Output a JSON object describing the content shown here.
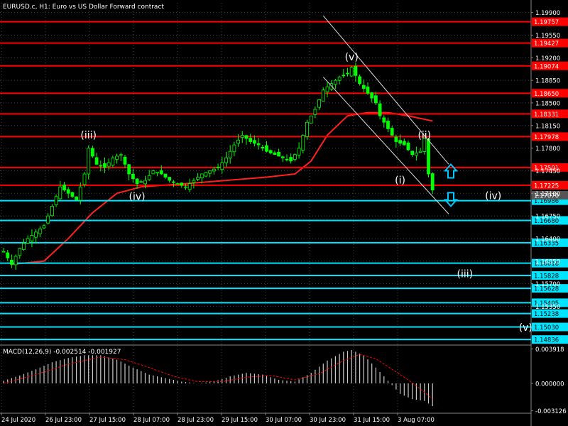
{
  "window": {
    "title": "EURUSD.c, H1:  Euro vs US Dollar Forward contract"
  },
  "macd": {
    "label": "MACD(12,26,9) -0.002514 -0.001927"
  },
  "colors": {
    "background": "#000000",
    "candle": "#00ff00",
    "moving_average": "#ff2020",
    "resistance_line": "#ff0000",
    "support_line": "#00e5ff",
    "channel": "#dddddd",
    "macd_histogram": "#cccccc",
    "macd_signal": "#ff0000",
    "wave_label": "#ffffff",
    "up_arrow": "#00c8ff",
    "down_arrow": "#00c8ff"
  },
  "chart_data": {
    "type": "candlestick",
    "symbol": "EURUSD.c",
    "timeframe": "H1",
    "y_axis_ticks": [
      "1.19900",
      "1.19550",
      "1.19200",
      "1.18850",
      "1.18500",
      "1.18150",
      "1.17800",
      "1.17450",
      "1.17100",
      "1.16750",
      "1.16400",
      "1.16050",
      "1.15700",
      "1.15350"
    ],
    "ylim": [
      1.1475,
      1.2005
    ],
    "x_axis_ticks": [
      "24 Jul 2020",
      "26 Jul 23:00",
      "27 Jul 15:00",
      "28 Jul 07:00",
      "28 Jul 23:00",
      "29 Jul 15:00",
      "30 Jul 07:00",
      "30 Jul 23:00",
      "31 Jul 15:00",
      "3 Aug 07:00"
    ],
    "price_series": {
      "type": "line",
      "interpretation": "approximate close path of the candlesticks, bar index 0..106",
      "points": [
        [
          0,
          1.162
        ],
        [
          2,
          1.16
        ],
        [
          4,
          1.1625
        ],
        [
          6,
          1.164
        ],
        [
          8,
          1.165
        ],
        [
          10,
          1.166
        ],
        [
          12,
          1.169
        ],
        [
          14,
          1.172
        ],
        [
          16,
          1.171
        ],
        [
          18,
          1.17
        ],
        [
          20,
          1.174
        ],
        [
          21,
          1.178
        ],
        [
          23,
          1.1755
        ],
        [
          25,
          1.175
        ],
        [
          27,
          1.1765
        ],
        [
          29,
          1.177
        ],
        [
          31,
          1.174
        ],
        [
          33,
          1.1725
        ],
        [
          35,
          1.173
        ],
        [
          37,
          1.1745
        ],
        [
          39,
          1.174
        ],
        [
          41,
          1.173
        ],
        [
          43,
          1.1725
        ],
        [
          45,
          1.172
        ],
        [
          47,
          1.173
        ],
        [
          49,
          1.174
        ],
        [
          51,
          1.1745
        ],
        [
          53,
          1.175
        ],
        [
          55,
          1.1765
        ],
        [
          57,
          1.1785
        ],
        [
          59,
          1.18
        ],
        [
          61,
          1.179
        ],
        [
          63,
          1.1785
        ],
        [
          65,
          1.1775
        ],
        [
          67,
          1.177
        ],
        [
          69,
          1.1765
        ],
        [
          71,
          1.176
        ],
        [
          73,
          1.178
        ],
        [
          75,
          1.182
        ],
        [
          77,
          1.184
        ],
        [
          79,
          1.187
        ],
        [
          81,
          1.188
        ],
        [
          83,
          1.189
        ],
        [
          85,
          1.1895
        ],
        [
          86,
          1.1905
        ],
        [
          88,
          1.188
        ],
        [
          90,
          1.1865
        ],
        [
          92,
          1.185
        ],
        [
          93,
          1.183
        ],
        [
          95,
          1.181
        ],
        [
          97,
          1.179
        ],
        [
          99,
          1.1785
        ],
        [
          101,
          1.177
        ],
        [
          103,
          1.1775
        ],
        [
          104,
          1.1795
        ],
        [
          105,
          1.174
        ],
        [
          106,
          1.1715
        ]
      ]
    },
    "moving_average": {
      "type": "line",
      "points": [
        [
          2,
          1.16
        ],
        [
          10,
          1.1605
        ],
        [
          16,
          1.164
        ],
        [
          22,
          1.168
        ],
        [
          28,
          1.171
        ],
        [
          34,
          1.172
        ],
        [
          45,
          1.1725
        ],
        [
          55,
          1.173
        ],
        [
          65,
          1.1735
        ],
        [
          72,
          1.174
        ],
        [
          76,
          1.176
        ],
        [
          80,
          1.18
        ],
        [
          85,
          1.183
        ],
        [
          90,
          1.1835
        ],
        [
          95,
          1.1835
        ],
        [
          100,
          1.183
        ],
        [
          106,
          1.1822
        ]
      ]
    },
    "horizontal_levels": [
      {
        "price": "1.19757",
        "kind": "resistance"
      },
      {
        "price": "1.19427",
        "kind": "resistance"
      },
      {
        "price": "1.19074",
        "kind": "resistance"
      },
      {
        "price": "1.18650",
        "kind": "resistance"
      },
      {
        "price": "1.18331",
        "kind": "resistance"
      },
      {
        "price": "1.17978",
        "kind": "resistance"
      },
      {
        "price": "1.17501",
        "kind": "resistance"
      },
      {
        "price": "1.17225",
        "kind": "resistance"
      },
      {
        "price": "1.16986",
        "kind": "support"
      },
      {
        "price": "1.16680",
        "kind": "support"
      },
      {
        "price": "1.16335",
        "kind": "support"
      },
      {
        "price": "1.16018",
        "kind": "support"
      },
      {
        "price": "1.15828",
        "kind": "support"
      },
      {
        "price": "1.15628",
        "kind": "support"
      },
      {
        "price": "1.15405",
        "kind": "support"
      },
      {
        "price": "1.15238",
        "kind": "support"
      },
      {
        "price": "1.15030",
        "kind": "support"
      },
      {
        "price": "1.14836",
        "kind": "support"
      }
    ],
    "current_price": "1.17070",
    "wave_labels": [
      {
        "text": "(iii)",
        "x": 21,
        "price": 1.1795
      },
      {
        "text": "(iv)",
        "x": 33,
        "price": 1.17
      },
      {
        "text": "(v)",
        "x": 86,
        "price": 1.1916
      },
      {
        "text": "(i)",
        "x": 98,
        "price": 1.1725
      },
      {
        "text": "(ii)",
        "x": 104,
        "price": 1.1795
      },
      {
        "text": "(iv)",
        "x": 121,
        "price": 1.1701
      },
      {
        "text": "(iii)",
        "x": 114,
        "price": 1.158
      },
      {
        "text": "(v)",
        "x": 129,
        "price": 1.1497
      }
    ],
    "channel": [
      {
        "x1": 79,
        "p1": 1.1985,
        "x2": 110,
        "p2": 1.1755
      },
      {
        "x1": 79,
        "p1": 1.189,
        "x2": 110,
        "p2": 1.1678
      }
    ],
    "arrows": [
      {
        "direction": "up",
        "x": 110,
        "price": 1.1745
      },
      {
        "direction": "down",
        "x": 110,
        "price": 1.17
      }
    ],
    "macd_histogram": {
      "type": "bar",
      "ylim": [
        -0.0034,
        0.0042
      ],
      "y_axis_ticks": [
        "0.003918",
        "0.000000",
        "-0.003126"
      ],
      "points": [
        [
          0,
          0.0003
        ],
        [
          4,
          0.0009
        ],
        [
          8,
          0.0016
        ],
        [
          12,
          0.0024
        ],
        [
          16,
          0.0029
        ],
        [
          20,
          0.0032
        ],
        [
          24,
          0.0032
        ],
        [
          28,
          0.0027
        ],
        [
          32,
          0.0018
        ],
        [
          36,
          0.001
        ],
        [
          40,
          0.0006
        ],
        [
          44,
          0.0002
        ],
        [
          48,
          0.0
        ],
        [
          52,
          0.0002
        ],
        [
          56,
          0.0008
        ],
        [
          60,
          0.0012
        ],
        [
          64,
          0.001
        ],
        [
          68,
          0.0004
        ],
        [
          72,
          0.0002
        ],
        [
          76,
          0.0012
        ],
        [
          80,
          0.0026
        ],
        [
          84,
          0.0036
        ],
        [
          86,
          0.0038
        ],
        [
          89,
          0.0032
        ],
        [
          92,
          0.0018
        ],
        [
          95,
          0.0003
        ],
        [
          98,
          -0.0012
        ],
        [
          101,
          -0.0018
        ],
        [
          104,
          -0.002
        ],
        [
          106,
          -0.0026
        ]
      ]
    },
    "macd_signal": {
      "type": "line",
      "points": [
        [
          0,
          0.0
        ],
        [
          8,
          0.001
        ],
        [
          16,
          0.0022
        ],
        [
          24,
          0.003
        ],
        [
          30,
          0.0027
        ],
        [
          36,
          0.0018
        ],
        [
          42,
          0.0008
        ],
        [
          48,
          0.0002
        ],
        [
          54,
          0.0002
        ],
        [
          60,
          0.0007
        ],
        [
          66,
          0.0009
        ],
        [
          72,
          0.0004
        ],
        [
          78,
          0.0011
        ],
        [
          84,
          0.0026
        ],
        [
          88,
          0.0033
        ],
        [
          92,
          0.0028
        ],
        [
          96,
          0.0016
        ],
        [
          100,
          0.0004
        ],
        [
          104,
          -0.001
        ],
        [
          106,
          -0.0018
        ]
      ]
    }
  }
}
